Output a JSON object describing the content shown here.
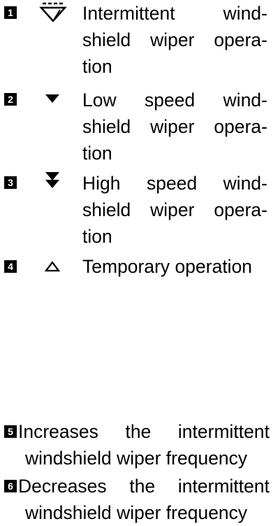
{
  "items": [
    {
      "number": "1",
      "icon": "intermittent-wiper-icon",
      "lines": [
        "Intermittent wind-",
        "shield wiper opera-",
        "tion"
      ]
    },
    {
      "number": "2",
      "icon": "low-speed-arrow-icon",
      "lines": [
        "Low speed wind-",
        "shield wiper opera-",
        "tion"
      ]
    },
    {
      "number": "3",
      "icon": "high-speed-double-arrow-icon",
      "lines": [
        "High speed wind-",
        "shield wiper opera-",
        "tion"
      ]
    },
    {
      "number": "4",
      "icon": "temporary-operation-triangle-icon",
      "lines": [
        "Temporary operation"
      ]
    }
  ],
  "notes": [
    {
      "number": "5",
      "lines": [
        "Increases the intermittent",
        "windshield wiper frequency"
      ]
    },
    {
      "number": "6",
      "lines": [
        "Decreases the intermittent",
        "windshield wiper frequency"
      ]
    }
  ]
}
